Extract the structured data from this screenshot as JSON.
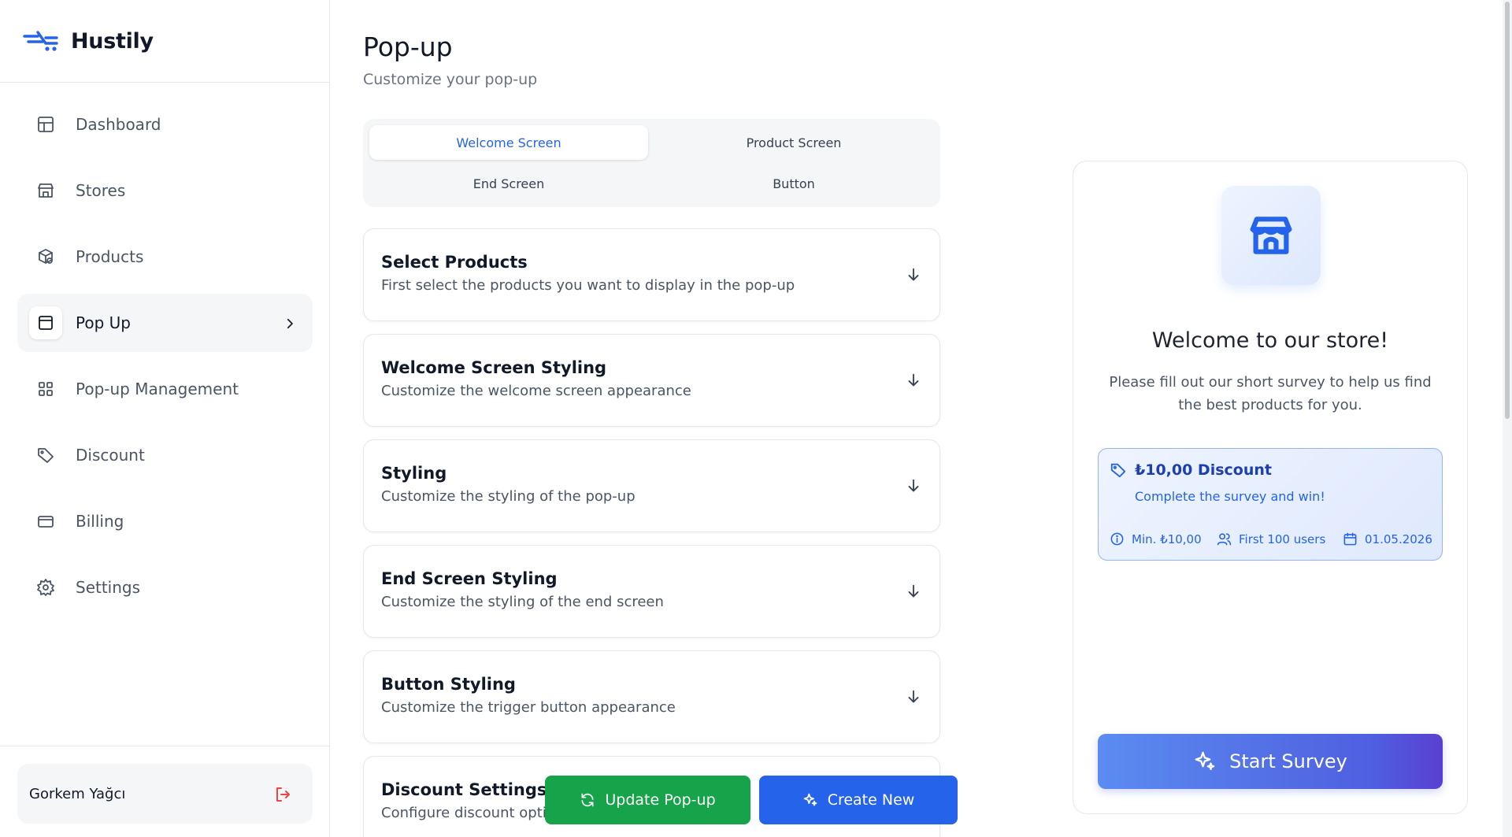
{
  "brand": {
    "name": "Hustily"
  },
  "sidebar": {
    "items": [
      {
        "label": "Dashboard",
        "icon": "dashboard-icon"
      },
      {
        "label": "Stores",
        "icon": "store-icon"
      },
      {
        "label": "Products",
        "icon": "products-icon"
      },
      {
        "label": "Pop Up",
        "icon": "popup-icon",
        "active": true
      },
      {
        "label": "Pop-up Management",
        "icon": "grid-icon"
      },
      {
        "label": "Discount",
        "icon": "tag-icon"
      },
      {
        "label": "Billing",
        "icon": "card-icon"
      },
      {
        "label": "Settings",
        "icon": "gear-icon"
      }
    ],
    "user": {
      "name": "Gorkem Yağcı"
    }
  },
  "main": {
    "title": "Pop-up",
    "subtitle": "Customize your pop-up",
    "tabs": [
      "Welcome Screen",
      "Product Screen",
      "End Screen",
      "Button"
    ],
    "active_tab": "Welcome Screen",
    "sections": [
      {
        "title": "Select Products",
        "desc": "First select the products you want to display in the pop-up"
      },
      {
        "title": "Welcome Screen Styling",
        "desc": "Customize the welcome screen appearance"
      },
      {
        "title": "Styling",
        "desc": "Customize the styling of the pop-up"
      },
      {
        "title": "End Screen Styling",
        "desc": "Customize the styling of the end screen"
      },
      {
        "title": "Button Styling",
        "desc": "Customize the trigger button appearance"
      },
      {
        "title": "Discount Settings",
        "desc": "Configure discount optio"
      }
    ],
    "buttons": {
      "update": "Update Pop-up",
      "create": "Create New"
    }
  },
  "preview": {
    "title": "Welcome to our store!",
    "desc": "Please fill out our short survey to help us find the best products for you.",
    "discount": {
      "title": "₺10,00 Discount",
      "subtitle": "Complete the survey and win!",
      "min": "Min. ₺10,00",
      "users": "First 100 users",
      "date": "01.05.2026"
    },
    "cta": "Start Survey"
  },
  "colors": {
    "accent": "#2563eb",
    "success": "#16a34a",
    "danger": "#ef4444"
  }
}
